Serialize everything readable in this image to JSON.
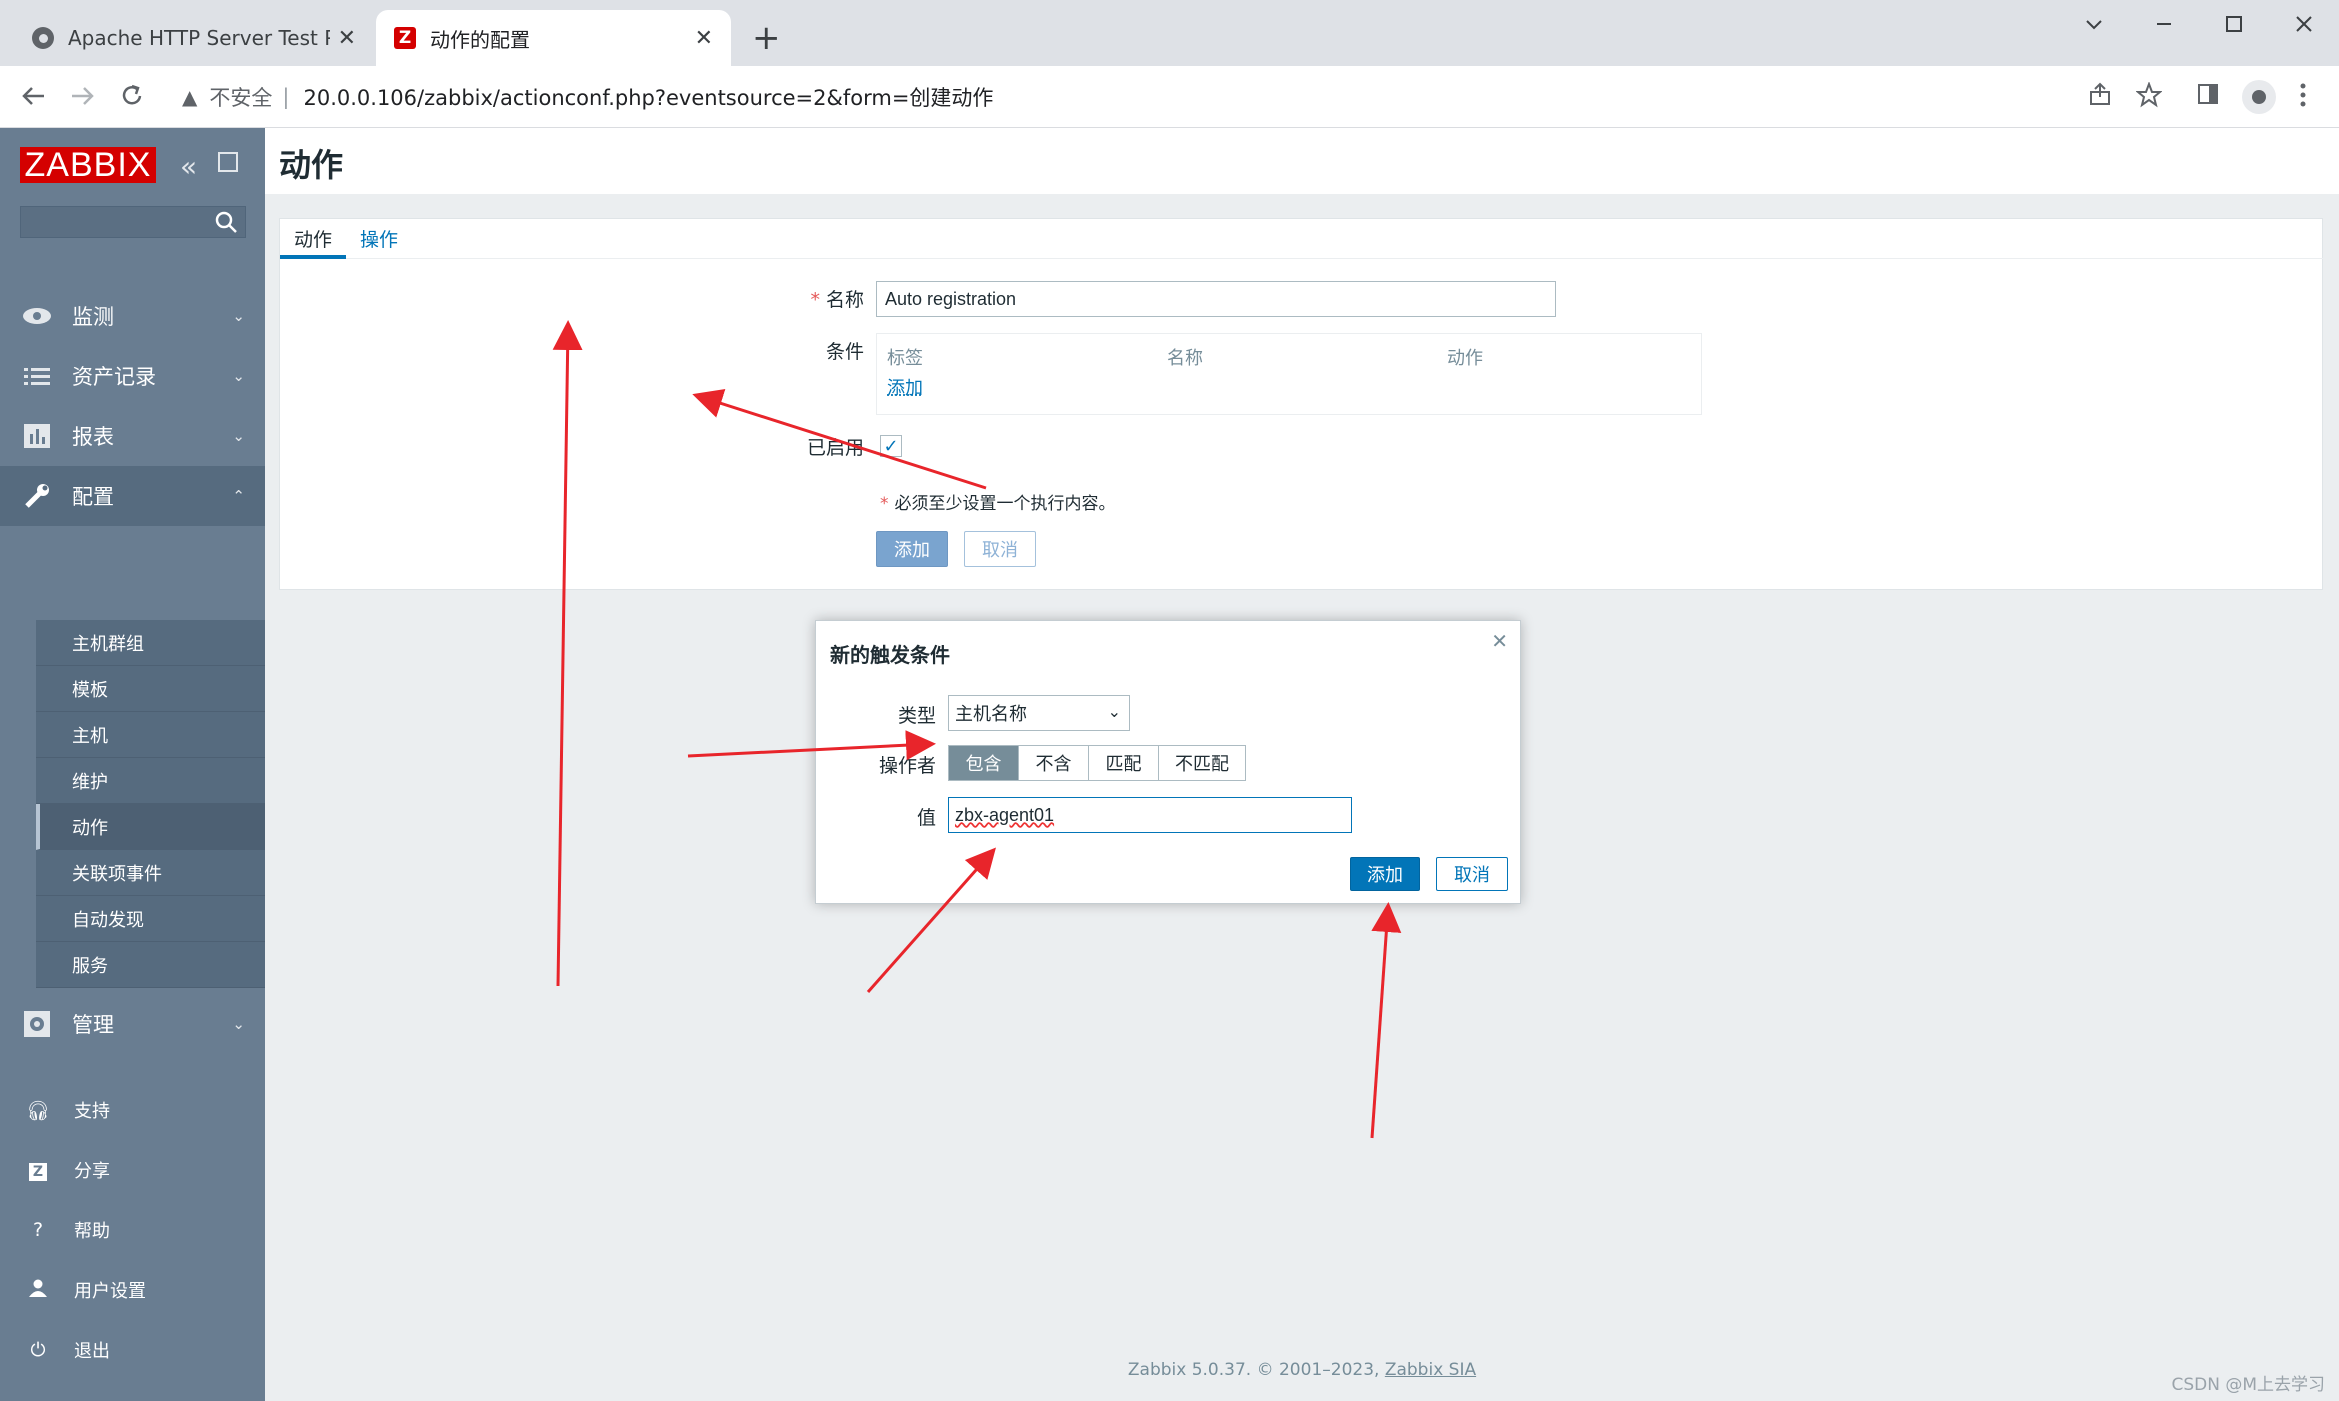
{
  "browser": {
    "tabs": [
      {
        "title": "Apache HTTP Server Test Page",
        "close": "✕"
      },
      {
        "title": "动作的配置",
        "close": "✕"
      }
    ],
    "new_tab": "+",
    "not_secure": "不安全",
    "url": "20.0.0.106/zabbix/actionconf.php?eventsource=2&form=创建动作"
  },
  "sidebar": {
    "logo": "ZABBIX",
    "menu": [
      {
        "label": "监测"
      },
      {
        "label": "资产记录"
      },
      {
        "label": "报表"
      },
      {
        "label": "配置"
      },
      {
        "label": "管理"
      }
    ],
    "config_submenu": [
      "主机群组",
      "模板",
      "主机",
      "维护",
      "动作",
      "关联项事件",
      "自动发现",
      "服务"
    ],
    "bottom": [
      {
        "label": "支持"
      },
      {
        "label": "分享"
      },
      {
        "label": "帮助"
      },
      {
        "label": "用户设置"
      },
      {
        "label": "退出"
      }
    ]
  },
  "page": {
    "title": "动作",
    "tabs": [
      "动作",
      "操作"
    ],
    "form": {
      "name_label": "名称",
      "name_value": "Auto registration",
      "conditions_label": "条件",
      "cond_headers": [
        "标签",
        "名称",
        "动作"
      ],
      "cond_add": "添加",
      "enabled_label": "已启用",
      "enabled": true,
      "note": "必须至少设置一个执行内容。",
      "add_button": "添加",
      "cancel_button": "取消"
    },
    "footer": {
      "text": "Zabbix 5.0.37. © 2001–2023, ",
      "brand": "Zabbix SIA"
    }
  },
  "dialog": {
    "title": "新的触发条件",
    "type_label": "类型",
    "type_value": "主机名称",
    "operator_label": "操作者",
    "operators": [
      "包含",
      "不含",
      "匹配",
      "不匹配"
    ],
    "operator_selected": "包含",
    "value_label": "值",
    "value": "zbx-agent01",
    "add_button": "添加",
    "cancel_button": "取消"
  },
  "watermark": "CSDN @M上去学习",
  "colors": {
    "accent": "#0275b8",
    "sidebar": "#697d91",
    "logo": "#d40000",
    "annotation_arrow": "#e8252b"
  }
}
